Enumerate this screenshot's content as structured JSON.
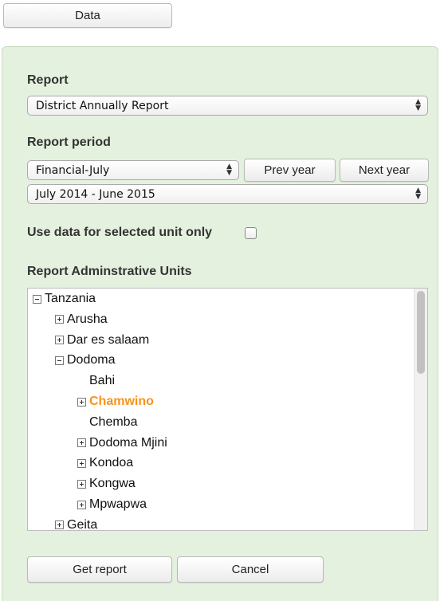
{
  "top": {
    "data_button": "Data"
  },
  "report": {
    "label": "Report",
    "selected": "District Annually Report"
  },
  "period": {
    "label": "Report period",
    "type_selected": "Financial-July",
    "prev_year": "Prev year",
    "next_year": "Next year",
    "range_selected": "July 2014 - June 2015"
  },
  "options": {
    "selected_unit_only_label": "Use data for selected unit only",
    "selected_unit_only_checked": false
  },
  "tree": {
    "label": "Report Adminstrative Units",
    "nodes": [
      {
        "text": "Tanzania",
        "toggle": "minus",
        "level": 0
      },
      {
        "text": "Arusha",
        "toggle": "plus",
        "level": 1
      },
      {
        "text": "Dar es salaam",
        "toggle": "plus",
        "level": 1
      },
      {
        "text": "Dodoma",
        "toggle": "minus",
        "level": 1
      },
      {
        "text": "Bahi",
        "toggle": "none",
        "level": 2
      },
      {
        "text": "Chamwino",
        "toggle": "plus",
        "level": 2,
        "selected": true
      },
      {
        "text": "Chemba",
        "toggle": "none",
        "level": 2
      },
      {
        "text": "Dodoma Mjini",
        "toggle": "plus",
        "level": 2
      },
      {
        "text": "Kondoa",
        "toggle": "plus",
        "level": 2
      },
      {
        "text": "Kongwa",
        "toggle": "plus",
        "level": 2
      },
      {
        "text": "Mpwapwa",
        "toggle": "plus",
        "level": 2
      },
      {
        "text": "Geita",
        "toggle": "plus",
        "level": 1
      }
    ]
  },
  "actions": {
    "get_report": "Get report",
    "cancel": "Cancel"
  },
  "colors": {
    "panel_bg": "#e5f1df",
    "selected_node": "#f7931e"
  }
}
